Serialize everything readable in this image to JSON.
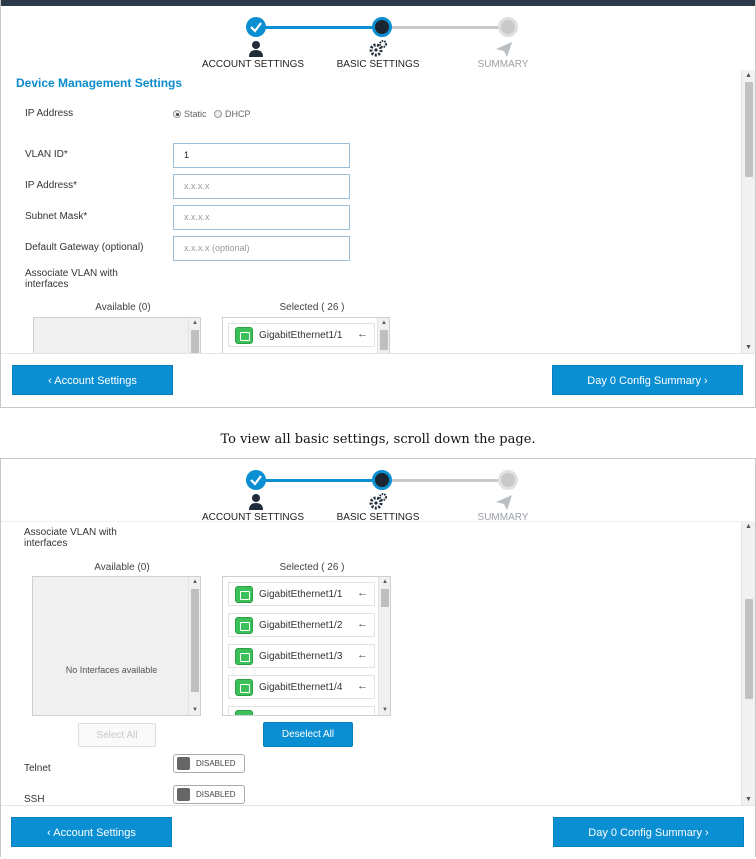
{
  "steps": [
    {
      "label": "ACCOUNT SETTINGS",
      "state": "done"
    },
    {
      "label": "BASIC SETTINGS",
      "state": "active"
    },
    {
      "label": "SUMMARY",
      "state": "pending"
    }
  ],
  "colors": {
    "accent": "#0b8fd3",
    "header_bar": "#2b3a48",
    "port_green": "#3cc15a"
  },
  "icons": {
    "step1": "check-icon",
    "step2": "gears-icon",
    "step3": "paper-plane-icon",
    "back": "chevron-left-icon",
    "next": "chevron-right-icon",
    "move": "arrow-left-icon",
    "iface": "ethernet-port-icon"
  },
  "form": {
    "section_title": "Device Management Settings",
    "ip_mode_label": "IP Address",
    "ip_mode_options": [
      "Static",
      "DHCP"
    ],
    "ip_mode_selected": "Static",
    "vlan_id_label": "VLAN ID*",
    "vlan_id_value": "1",
    "ip_address_label": "IP Address*",
    "ip_address_placeholder": "x.x.x.x",
    "subnet_label": "Subnet Mask*",
    "subnet_placeholder": "x.x.x.x",
    "gateway_label": "Default Gateway (optional)",
    "gateway_placeholder": "x.x.x.x (optional)",
    "assoc_label_1": "Associate VLAN with",
    "assoc_label_2": "interfaces"
  },
  "lists": {
    "available_header": "Available (0)",
    "selected_header": "Selected ( 26 )",
    "empty_text": "No Interfaces available",
    "selected_items": [
      "GigabitEthernet1/1",
      "GigabitEthernet1/2",
      "GigabitEthernet1/3",
      "GigabitEthernet1/4"
    ],
    "select_all": "Select All",
    "deselect_all": "Deselect All"
  },
  "toggles": {
    "telnet_label": "Telnet",
    "telnet_state": "DISABLED",
    "ssh_label": "SSH",
    "ssh_state": "DISABLED"
  },
  "footer": {
    "back_label": "Account Settings",
    "next_label": "Day 0 Config Summary"
  },
  "caption": "To view all basic settings, scroll down the page."
}
